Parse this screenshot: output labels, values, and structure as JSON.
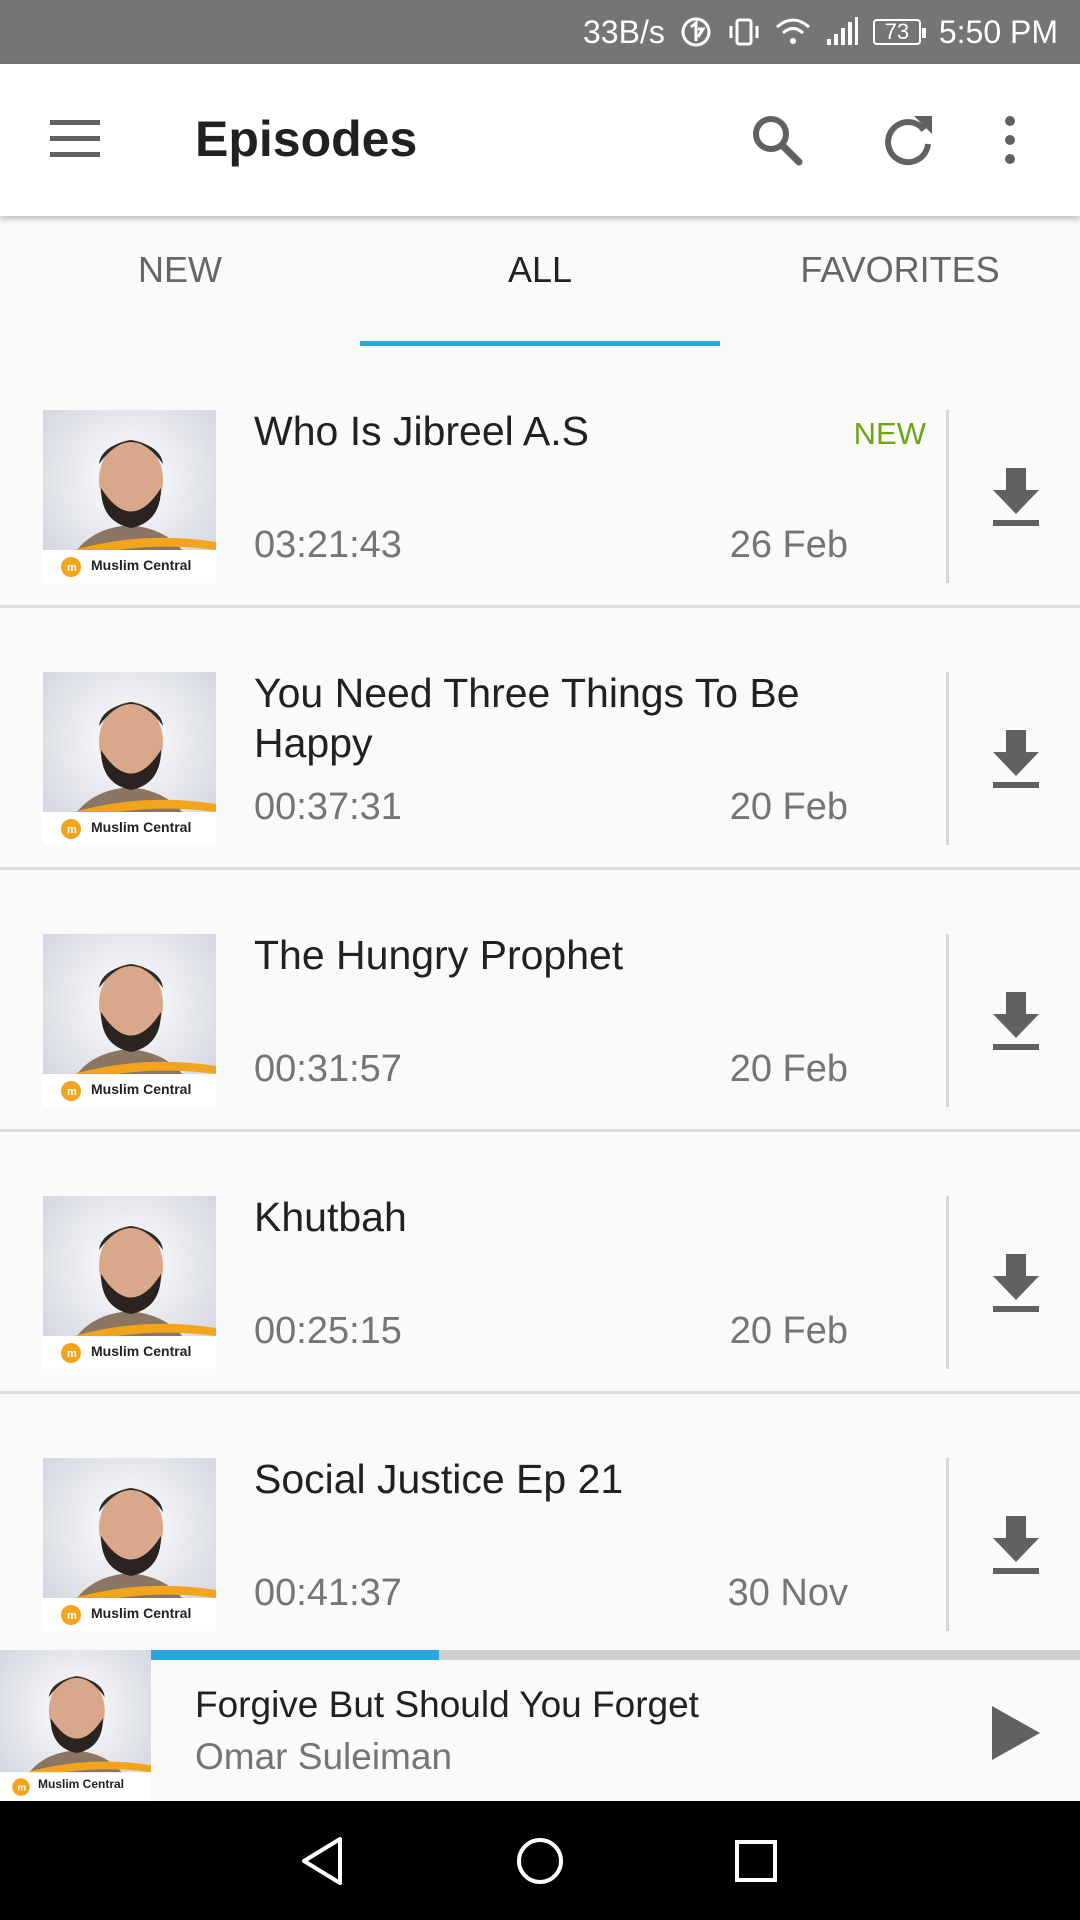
{
  "status_bar": {
    "net_speed": "33B/s",
    "battery": "73",
    "time": "5:50 PM",
    "icons": [
      "data-saver-icon",
      "vibrate-icon",
      "wifi-icon",
      "signal-icon",
      "battery-icon"
    ]
  },
  "app_bar": {
    "title": "Episodes",
    "icons": [
      "menu-icon",
      "search-icon",
      "refresh-icon",
      "more-vert-icon"
    ]
  },
  "tabs": [
    {
      "label": "NEW",
      "active": false
    },
    {
      "label": "ALL",
      "active": true
    },
    {
      "label": "FAVORITES",
      "active": false
    }
  ],
  "thumbnail_brand": "Muslim Central",
  "episodes": [
    {
      "title": "Who Is Jibreel A.S",
      "badge": "NEW",
      "duration": "03:21:43",
      "date": "26 Feb"
    },
    {
      "title": "You Need Three Things To Be Happy",
      "badge": "",
      "duration": "00:37:31",
      "date": "20 Feb"
    },
    {
      "title": "The Hungry Prophet",
      "badge": "",
      "duration": "00:31:57",
      "date": "20 Feb"
    },
    {
      "title": "Khutbah",
      "badge": "",
      "duration": "00:25:15",
      "date": "20 Feb"
    },
    {
      "title": "Social Justice Ep 21",
      "badge": "",
      "duration": "00:41:37",
      "date": "30 Nov"
    }
  ],
  "player": {
    "title": "Forgive But Should You Forget",
    "artist": "Omar Suleiman",
    "progress_fraction": 0.31
  },
  "colors": {
    "accent": "#29a8e0",
    "new_badge": "#6ea514",
    "brand_orange": "#f2a41c"
  }
}
